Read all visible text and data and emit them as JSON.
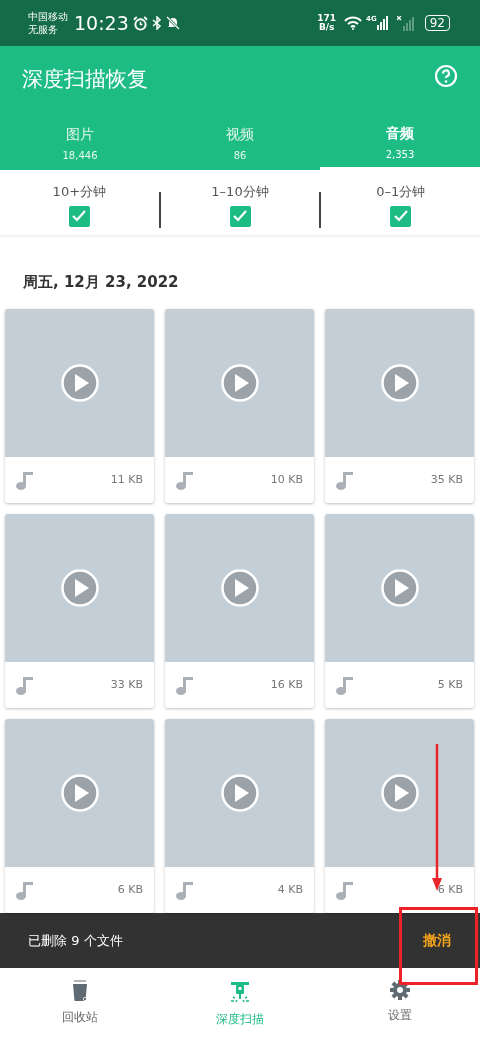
{
  "status_bar": {
    "carrier": "中国移动",
    "service": "无服务",
    "time": "10:23",
    "speed_value": "171",
    "speed_unit": "B/s",
    "network": "4G",
    "battery": "92"
  },
  "header": {
    "title": "深度扫描恢复"
  },
  "tabs": [
    {
      "label": "图片",
      "count": "18,446",
      "selected": false
    },
    {
      "label": "视频",
      "count": "86",
      "selected": false
    },
    {
      "label": "音频",
      "count": "2,353",
      "selected": true
    }
  ],
  "filters": [
    {
      "label": "10+分钟",
      "checked": true
    },
    {
      "label": "1–10分钟",
      "checked": true
    },
    {
      "label": "0–1分钟",
      "checked": true
    }
  ],
  "date_header": "周五, 12月 23, 2022",
  "files": [
    {
      "size": "11 KB"
    },
    {
      "size": "10 KB"
    },
    {
      "size": "35 KB"
    },
    {
      "size": "33 KB"
    },
    {
      "size": "16 KB"
    },
    {
      "size": "5 KB"
    },
    {
      "size": "6 KB"
    },
    {
      "size": "4 KB"
    },
    {
      "size": "6 KB"
    }
  ],
  "snackbar": {
    "message": "已删除 9 个文件",
    "action": "撤消"
  },
  "bottom_nav": [
    {
      "label": "回收站",
      "kind": "bin",
      "selected": false
    },
    {
      "label": "深度扫描",
      "kind": "scan",
      "selected": true
    },
    {
      "label": "设置",
      "kind": "gear",
      "selected": false
    }
  ],
  "annotations": {
    "arrow_shown": true,
    "frame_shown": true
  }
}
